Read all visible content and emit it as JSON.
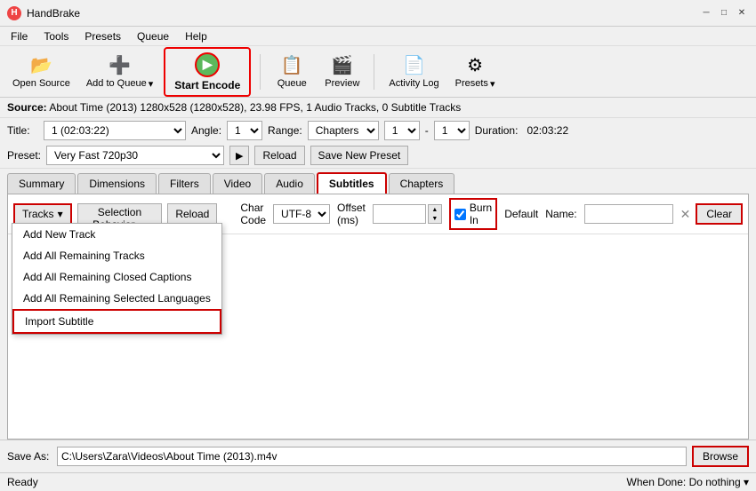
{
  "app": {
    "title": "HandBrake",
    "icon": "H"
  },
  "titlebar": {
    "minimize": "─",
    "maximize": "□",
    "close": "✕"
  },
  "menu": {
    "items": [
      "File",
      "Tools",
      "Presets",
      "Queue",
      "Help"
    ]
  },
  "toolbar": {
    "open_source": "Open Source",
    "add_to_queue": "Add to Queue",
    "start_encode": "Start Encode",
    "queue": "Queue",
    "preview": "Preview",
    "activity_log": "Activity Log",
    "presets": "Presets"
  },
  "source": {
    "label": "Source:",
    "value": "About Time (2013)  1280x528 (1280x528), 23.98 FPS, 1 Audio Tracks, 0 Subtitle Tracks"
  },
  "title_row": {
    "title_label": "Title:",
    "title_value": "1 (02:03:22)",
    "angle_label": "Angle:",
    "angle_value": "1",
    "range_label": "Range:",
    "range_value": "Chapters",
    "chapter_start": "1",
    "chapter_end": "1",
    "duration_label": "Duration:",
    "duration_value": "02:03:22"
  },
  "preset_row": {
    "label": "Preset:",
    "value": "Very Fast 720p30",
    "reload_label": "Reload",
    "save_label": "Save New Preset"
  },
  "tabs": [
    {
      "id": "summary",
      "label": "Summary"
    },
    {
      "id": "dimensions",
      "label": "Dimensions"
    },
    {
      "id": "filters",
      "label": "Filters"
    },
    {
      "id": "video",
      "label": "Video"
    },
    {
      "id": "audio",
      "label": "Audio"
    },
    {
      "id": "subtitles",
      "label": "Subtitles",
      "active": true
    },
    {
      "id": "chapters",
      "label": "Chapters"
    }
  ],
  "subtitles": {
    "tracks_label": "Tracks",
    "selection_behavior_label": "Selection Behavior ...",
    "reload_label": "Reload",
    "clear_label": "Clear",
    "char_code_label": "Char Code",
    "char_code_value": "UTF-8",
    "offset_label": "Offset (ms)",
    "burn_in_label": "Burn In",
    "burn_in_checked": true,
    "default_label": "Default",
    "name_label": "Name:"
  },
  "dropdown": {
    "items": [
      {
        "label": "Add New Track",
        "highlighted": false
      },
      {
        "label": "Add All Remaining Tracks",
        "highlighted": false
      },
      {
        "label": "Add All Remaining Closed Captions",
        "highlighted": false
      },
      {
        "label": "Add All Remaining Selected Languages",
        "highlighted": false
      },
      {
        "label": "Import Subtitle",
        "highlighted": true
      }
    ]
  },
  "save_as": {
    "label": "Save As:",
    "path": "C:\\Users\\Zara\\Videos\\About Time (2013).m4v",
    "browse_label": "Browse"
  },
  "status": {
    "left": "Ready",
    "right_label": "When Done:",
    "right_value": "Do nothing"
  }
}
